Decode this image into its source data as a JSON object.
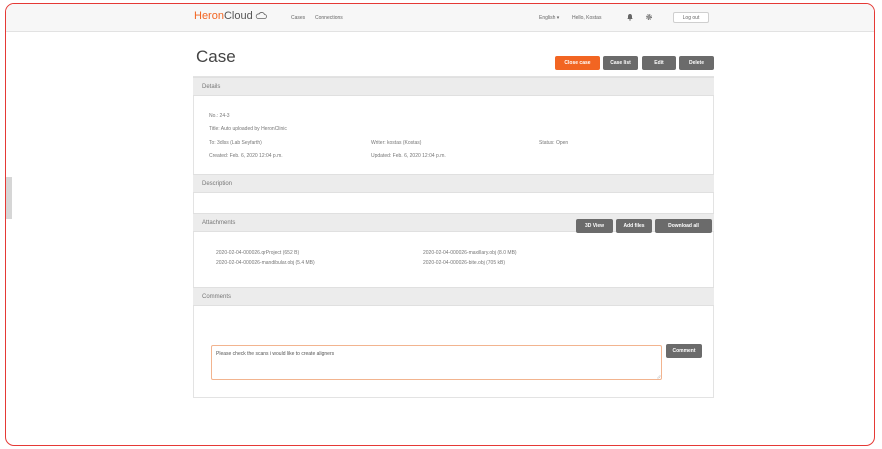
{
  "nav": {
    "brand_heron": "Heron",
    "brand_cloud": "Cloud",
    "links": [
      "Cases",
      "Connections"
    ],
    "language": "English ▾",
    "greeting": "Hello, Kostas",
    "logout": "Log out"
  },
  "page": {
    "title": "Case",
    "buttons": {
      "close_case": "Close case",
      "case_list": "Case list",
      "edit": "Edit",
      "delete": "Delete"
    }
  },
  "details": {
    "header": "Details",
    "no": "No.: 24-3",
    "title": "Title: Auto uploaded by HeronClinic",
    "to": "To: 3dlss (Lab Seyfarth)",
    "writer": "Writer: kostas (Kostas)",
    "status": "Status: Open",
    "created": "Created: Feb. 6, 2020 12:04 p.m.",
    "updated": "Updated: Feb. 6, 2020 12:04 p.m."
  },
  "description": {
    "header": "Description"
  },
  "attachments": {
    "header": "Attachments",
    "buttons": {
      "view_3d": "3D View",
      "add_files": "Add files",
      "download_all": "Download all"
    },
    "files": [
      "2020-02-04-000026.qrProject (652 B)",
      "2020-02-04-000026-maxillary.obj (8.0 MB)",
      "2020-02-04-000026-mandibular.obj (5.4 MB)",
      "2020-02-04-000026-bite.obj (705 kB)"
    ]
  },
  "comments": {
    "header": "Comments",
    "input_value": "Please check the scans i would like to create aligners",
    "submit": "Comment"
  },
  "colors": {
    "accent": "#f26522",
    "button_dark": "#6b6b6b",
    "frame_border": "#e53935"
  },
  "icons": {
    "bell": "bell-icon",
    "gear": "gear-icon",
    "cloud": "cloud-icon"
  }
}
